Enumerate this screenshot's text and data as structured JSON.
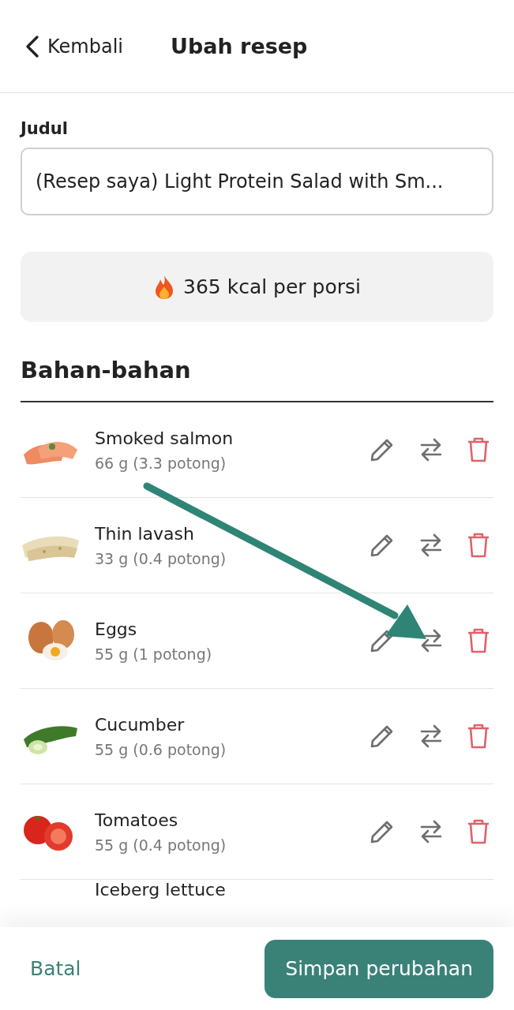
{
  "header": {
    "back_label": "Kembali",
    "title": "Ubah resep"
  },
  "title_field": {
    "label": "Judul",
    "value": "(Resep saya) Light Protein Salad with Sm..."
  },
  "calories": "365 kcal per porsi",
  "ingredients_heading": "Bahan-bahan",
  "ingredients": [
    {
      "name": "Smoked salmon",
      "amount": "66 g (3.3 potong)"
    },
    {
      "name": "Thin lavash",
      "amount": "33 g (0.4 potong)"
    },
    {
      "name": "Eggs",
      "amount": "55 g (1 potong)"
    },
    {
      "name": "Cucumber",
      "amount": "55 g (0.6 potong)"
    },
    {
      "name": "Tomatoes",
      "amount": "55 g (0.4 potong)"
    },
    {
      "name": "Iceberg lettuce"
    }
  ],
  "footer": {
    "cancel": "Batal",
    "save": "Simpan perubahan"
  }
}
